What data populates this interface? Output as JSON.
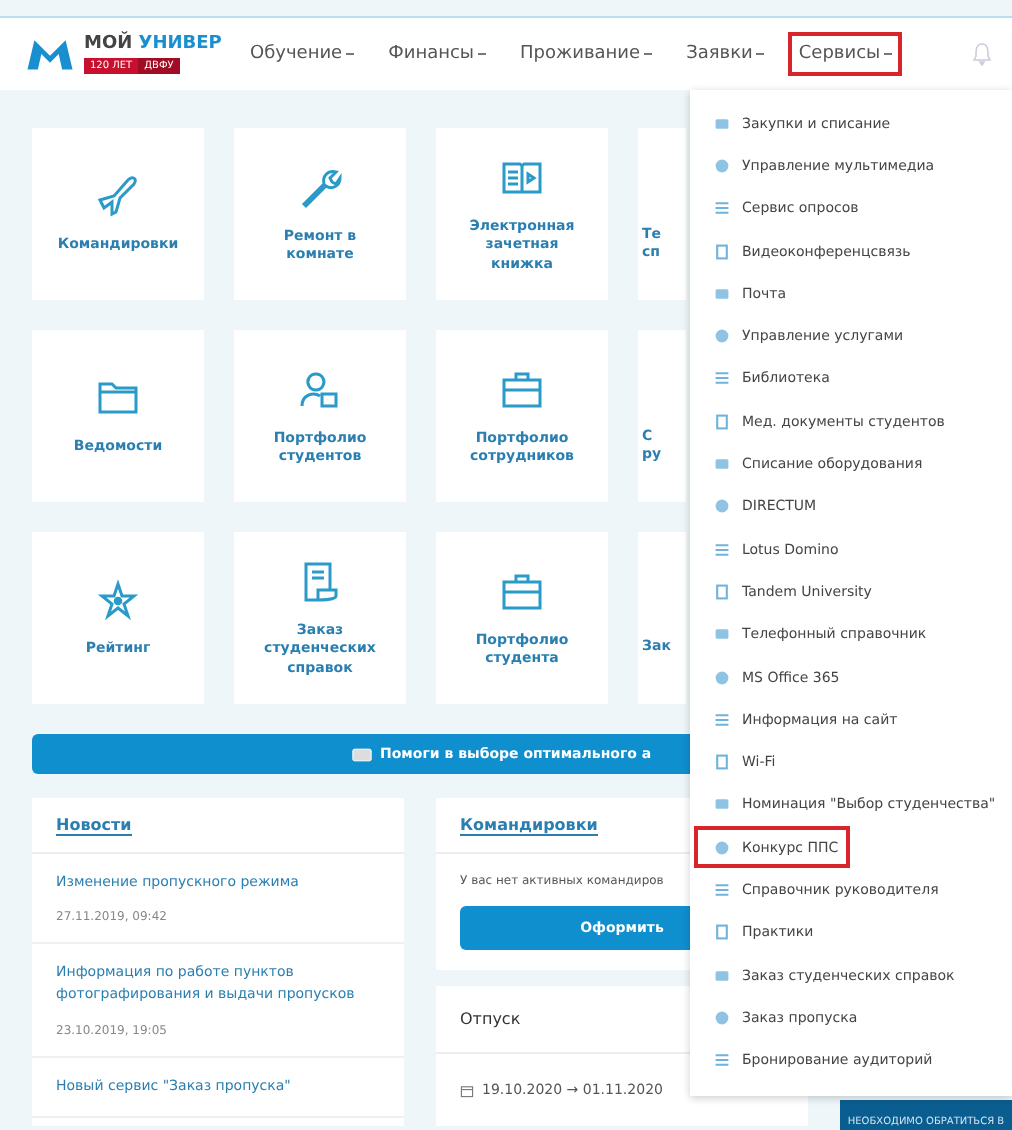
{
  "logo": {
    "title_part1": "МОЙ",
    "title_part2": "УНИВЕР",
    "ribbon_left": "120 ЛЕТ",
    "ribbon_right": "ДВФУ"
  },
  "nav": [
    {
      "label": "Обучение",
      "highlighted": false
    },
    {
      "label": "Финансы",
      "highlighted": false
    },
    {
      "label": "Проживание",
      "highlighted": false
    },
    {
      "label": "Заявки",
      "highlighted": false
    },
    {
      "label": "Сервисы",
      "highlighted": true
    }
  ],
  "tiles": [
    {
      "kind": "full",
      "label": "Командировки"
    },
    {
      "kind": "full",
      "label": "Ремонт в комнате"
    },
    {
      "kind": "full",
      "label": "Электронная зачетная книжка"
    },
    {
      "kind": "partial",
      "lines": [
        "Те",
        "сп"
      ]
    },
    {
      "kind": "full",
      "label": "Ведомости"
    },
    {
      "kind": "full",
      "label": "Портфолио студентов"
    },
    {
      "kind": "full",
      "label": "Портфолио сотрудников"
    },
    {
      "kind": "partial",
      "lines": [
        "С",
        "ру"
      ]
    },
    {
      "kind": "full",
      "label": "Рейтинг"
    },
    {
      "kind": "full",
      "label": "Заказ студенческих справок"
    },
    {
      "kind": "full",
      "label": "Портфолио студента"
    },
    {
      "kind": "partial",
      "lines": [
        "Зак"
      ]
    }
  ],
  "banner": {
    "text": "Помоги в выборе оптимального а"
  },
  "news": {
    "title": "Новости",
    "items": [
      {
        "title": "Изменение пропускного режима",
        "date": "27.11.2019, 09:42"
      },
      {
        "title": "Информация по работе пунктов фотографирования и выдачи пропусков",
        "date": "23.10.2019, 19:05"
      },
      {
        "title": "Новый сервис \"Заказ пропуска\""
      }
    ]
  },
  "trips": {
    "title": "Командировки",
    "text": "У вас нет активных командиров",
    "button": "Оформить"
  },
  "vacation": {
    "title": "Отпуск",
    "dates": "19.10.2020 → 01.11.2020"
  },
  "corner_button": "НЕОБХОДИМО ОБРАТИТЬСЯ В",
  "services_menu": [
    {
      "label": "Закупки и списание",
      "highlighted": false
    },
    {
      "label": "Управление мультимедиа",
      "highlighted": false
    },
    {
      "label": "Сервис опросов",
      "highlighted": false
    },
    {
      "label": "Видеоконференцсвязь",
      "highlighted": false
    },
    {
      "label": "Почта",
      "highlighted": false
    },
    {
      "label": "Управление услугами",
      "highlighted": false
    },
    {
      "label": "Библиотека",
      "highlighted": false
    },
    {
      "label": "Мед. документы студентов",
      "highlighted": false
    },
    {
      "label": "Списание оборудования",
      "highlighted": false
    },
    {
      "label": "DIRECTUM",
      "highlighted": false
    },
    {
      "label": "Lotus Domino",
      "highlighted": false
    },
    {
      "label": "Tandem University",
      "highlighted": false
    },
    {
      "label": "Телефонный справочник",
      "highlighted": false
    },
    {
      "label": "MS Office 365",
      "highlighted": false
    },
    {
      "label": "Информация на сайт",
      "highlighted": false
    },
    {
      "label": "Wi-Fi",
      "highlighted": false
    },
    {
      "label": "Номинация \"Выбор студенчества\"",
      "highlighted": false
    },
    {
      "label": "Конкурс ППС",
      "highlighted": true
    },
    {
      "label": "Справочник руководителя",
      "highlighted": false
    },
    {
      "label": "Практики",
      "highlighted": false
    },
    {
      "label": "Заказ студенческих справок",
      "highlighted": false
    },
    {
      "label": "Заказ пропуска",
      "highlighted": false
    },
    {
      "label": "Бронирование аудиторий",
      "highlighted": false
    }
  ]
}
